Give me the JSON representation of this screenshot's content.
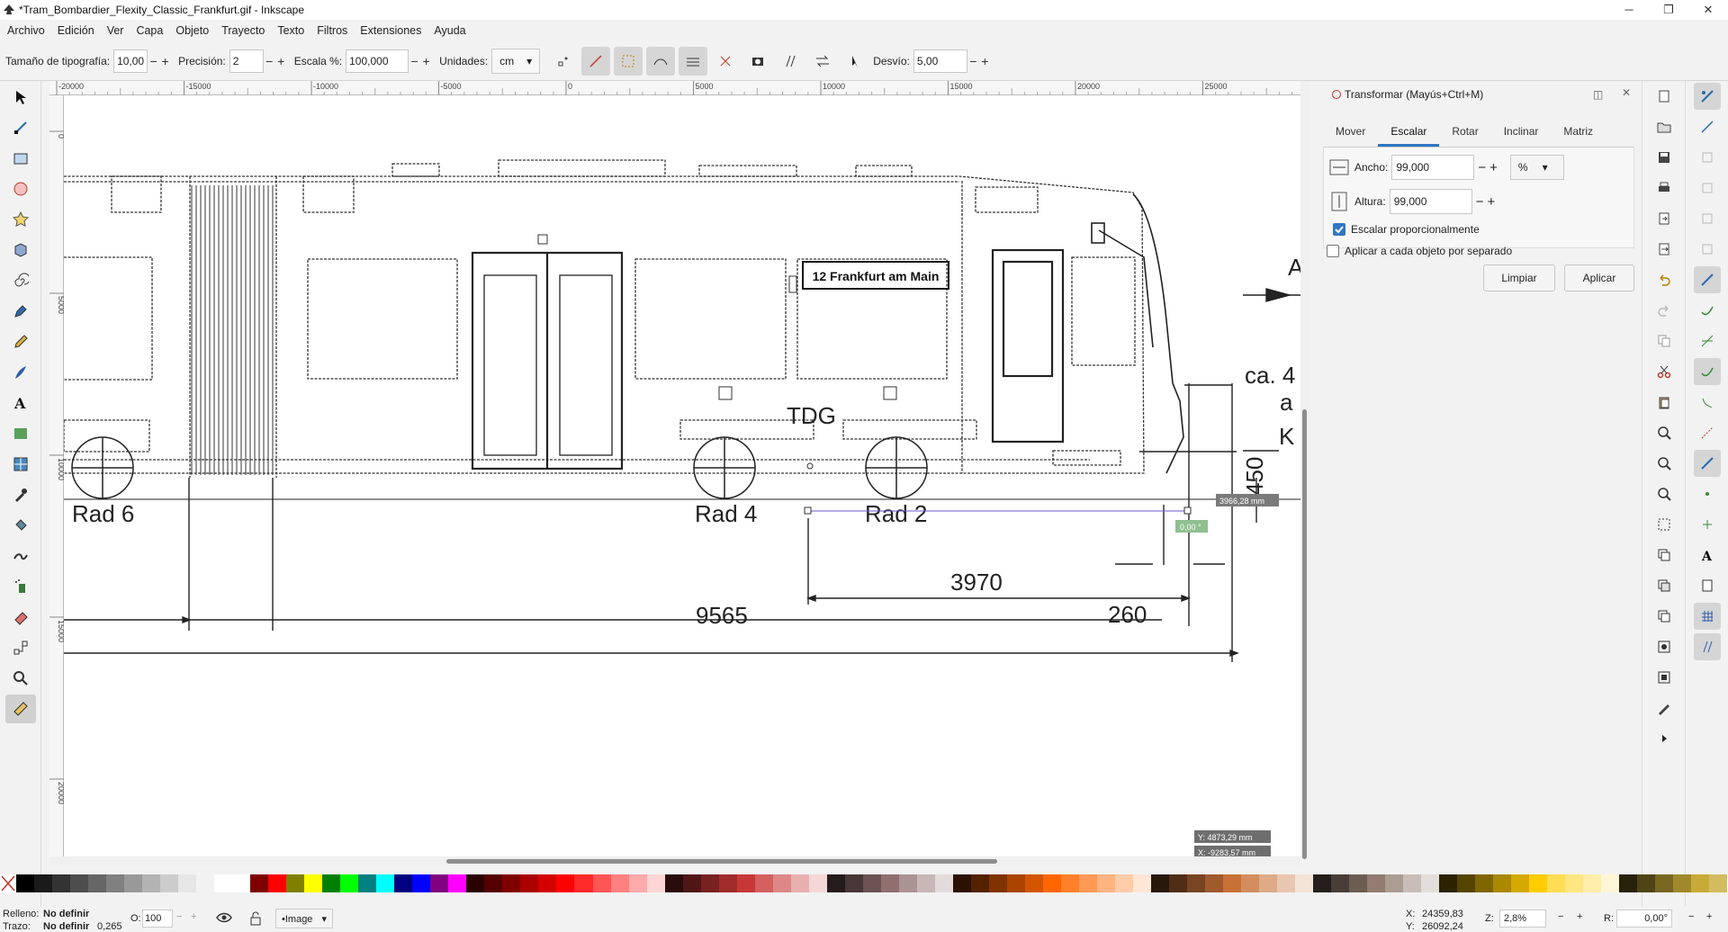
{
  "window": {
    "title": "*Tram_Bombardier_Flexity_Classic_Frankfurt.gif - Inkscape",
    "minimize": "─",
    "maximize": "❐",
    "close": "✕"
  },
  "menu": [
    "Archivo",
    "Edición",
    "Ver",
    "Capa",
    "Objeto",
    "Trayecto",
    "Texto",
    "Filtros",
    "Extensiones",
    "Ayuda"
  ],
  "toolctl": {
    "font_size_label": "Tamaño de tipografía:",
    "font_size": "10,00",
    "precision_label": "Precisión:",
    "precision": "2",
    "scale_label": "Escala %:",
    "scale": "100,000",
    "units_label": "Unidades:",
    "units": "cm",
    "offset_label": "Desvío:",
    "offset": "5,00"
  },
  "ruler": {
    "h_ticks": [
      "-20000",
      "-15000",
      "-10000",
      "-5000",
      "0",
      "5000",
      "10000",
      "15000",
      "20000",
      "25000"
    ],
    "v_ticks": [
      "0",
      "5000",
      "10000",
      "15000",
      "20000"
    ]
  },
  "drawing": {
    "sign": "12 Frankfurt am Main",
    "tdg": "TDG",
    "rad6": "Rad 6",
    "rad4": "Rad 4",
    "rad2": "Rad 2",
    "dim_260": "260",
    "dim_3970": "3970",
    "dim_9565": "9565",
    "dim_450": "450",
    "ca": "ca. 4",
    "a": "a",
    "k": "K",
    "a_big": "A",
    "measure": "3966,28 mm",
    "angle": "0,00 °",
    "ylabel": "Y: 4873,29 mm",
    "xlabel": "X: -9283,57 mm"
  },
  "dock": {
    "title": "Transformar (Mayús+Ctrl+M)",
    "tabs": [
      "Mover",
      "Escalar",
      "Rotar",
      "Inclinar",
      "Matriz"
    ],
    "active_tab": "Escalar",
    "width_label": "Ancho:",
    "width": "99,000",
    "height_label": "Altura:",
    "height": "99,000",
    "unit": "%",
    "proportional": "Escalar proporcionalmente",
    "separately": "Aplicar a cada objeto por separado",
    "clear": "Limpiar",
    "apply": "Aplicar"
  },
  "palette": [
    "#000000",
    "#1a1a1a",
    "#333333",
    "#4d4d4d",
    "#666666",
    "#808080",
    "#999999",
    "#b3b3b3",
    "#cccccc",
    "#e6e6e6",
    "#f2f2f2",
    "#ffffff",
    "#ffffff",
    "#800000",
    "#ff0000",
    "#808000",
    "#ffff00",
    "#008000",
    "#00ff00",
    "#008080",
    "#00ffff",
    "#000080",
    "#0000ff",
    "#800080",
    "#ff00ff",
    "#2b0000",
    "#550000",
    "#800000",
    "#aa0000",
    "#d40000",
    "#ff0000",
    "#ff2a2a",
    "#ff5555",
    "#ff8080",
    "#ffaaaa",
    "#ffd5d5",
    "#280b0b",
    "#501616",
    "#782121",
    "#a02c2c",
    "#c83737",
    "#d35f5f",
    "#de8787",
    "#e9afaf",
    "#f4d7d7",
    "#241c1c",
    "#483737",
    "#6c5353",
    "#916f6f",
    "#ac9393",
    "#c8b7b7",
    "#e3dbdb",
    "#2b1100",
    "#552200",
    "#803300",
    "#aa4400",
    "#d45500",
    "#ff6600",
    "#ff7f2a",
    "#ff9955",
    "#ffb380",
    "#ffccaa",
    "#ffe6d5",
    "#28170b",
    "#502d16",
    "#784421",
    "#a05a2c",
    "#c87137",
    "#d38d5f",
    "#deaa87",
    "#e9c6af",
    "#f4e3d7",
    "#241f1c",
    "#483e37",
    "#6c5d53",
    "#917c6f",
    "#ac9d93",
    "#c8beb7",
    "#e3dedb",
    "#2b2200",
    "#554400",
    "#806600",
    "#aa8800",
    "#d4aa00",
    "#ffcc00",
    "#ffdd55",
    "#ffe680",
    "#ffeeaa",
    "#fff6d5",
    "#28220b",
    "#504416",
    "#786721",
    "#a0892c",
    "#c8ab37",
    "#d3bc5f"
  ],
  "status": {
    "fill_label": "Relleno:",
    "fill": "No definir",
    "stroke_label": "Trazo:",
    "stroke": "No definir",
    "stroke_w": "0,265",
    "opacity_label": "O:",
    "opacity": "100",
    "layer": "•Image",
    "x_label": "X:",
    "x": "24359,83",
    "y_label": "Y:",
    "y": "26092,24",
    "zoom_label": "Z:",
    "zoom": "2,8%",
    "rot_label": "R:",
    "rot": "0,00°"
  }
}
